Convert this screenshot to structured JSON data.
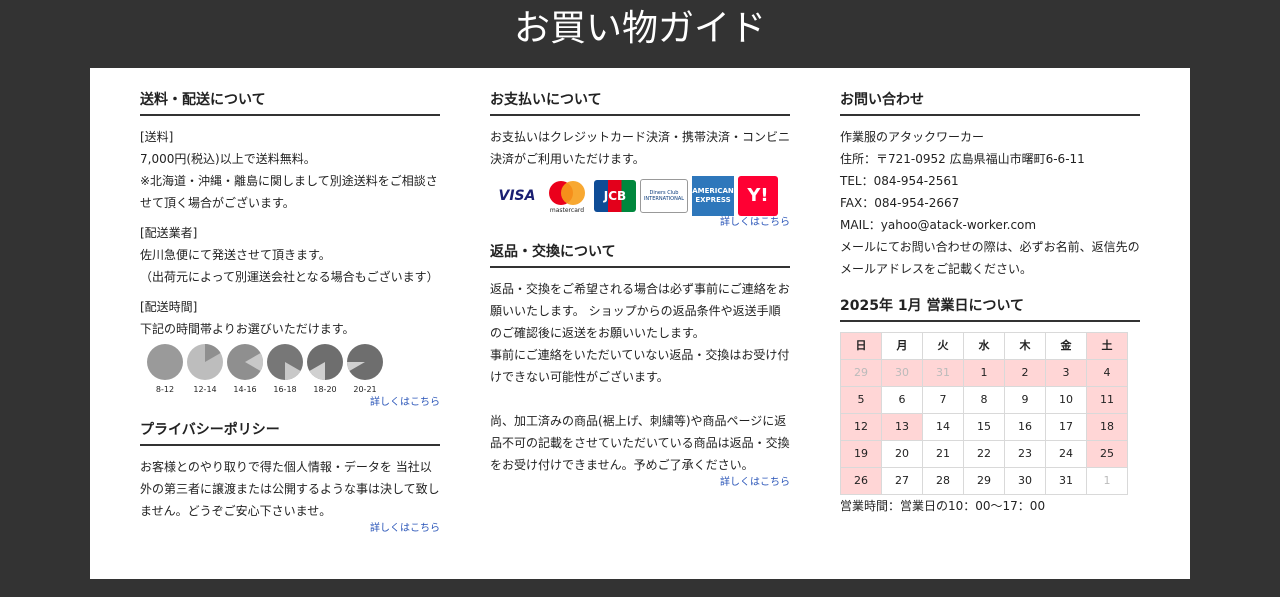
{
  "title": "お買い物ガイド",
  "shipping": {
    "heading": "送料・配送について",
    "fee_label": "[送料]",
    "fee_text1": "7,000円(税込)以上で送料無料。",
    "fee_text2a": "※北海道・沖縄・離島に関しまして別途送料をご相談さ",
    "fee_text2b": "せて頂く場合がございます。",
    "carrier_label": "[配送業者]",
    "carrier_text1": "佐川急便にて発送させて頂きます。",
    "carrier_text2": "（出荷元によって別運送会社となる場合もございます）",
    "time_label": "[配送時間]",
    "time_text": "下記の時間帯よりお選びいただけます。",
    "slots": [
      "8-12",
      "12-14",
      "14-16",
      "16-18",
      "18-20",
      "20-21"
    ],
    "more": "詳しくはこちら"
  },
  "privacy": {
    "heading": "プライバシーポリシー",
    "line1": "お客様とのやり取りで得た個人情報・データを 当社以",
    "line2": "外の第三者に譲渡または公開するような事は決して致し",
    "line3": "ません。どうぞご安心下さいませ。",
    "more": "詳しくはこちら"
  },
  "payment": {
    "heading": "お支払いについて",
    "line1": "お支払いはクレジットカード決済・携帯決済・コンビニ",
    "line2": "決済がご利用いただけます。",
    "cards": [
      "VISA",
      "mastercard",
      "JCB",
      "Diners Club INTERNATIONAL",
      "AMERICAN EXPRESS",
      "Y!"
    ],
    "more": "詳しくはこちら"
  },
  "returns": {
    "heading": "返品・交換について",
    "l1": "返品・交換をご希望される場合は必ず事前にご連絡をお",
    "l2": "願いいたします。 ショップからの返品条件や返送手順",
    "l3": "のご確認後に返送をお願いいたします。",
    "l4": "事前にご連絡をいただいていない返品・交換はお受け付",
    "l5": "けできない可能性がございます。",
    "l6": "尚、加工済みの商品(裾上げ、刺繍等)や商品ページに返",
    "l7": "品不可の記載をさせていただいている商品は返品・交換",
    "l8": "をお受け付けできません。予めご了承ください。",
    "more": "詳しくはこちら"
  },
  "contact": {
    "heading": "お問い合わせ",
    "company": "作業服のアタックワーカー",
    "address": "住所：〒721-0952 広島県福山市曙町6-6-11",
    "tel": "TEL：084-954-2561",
    "fax": "FAX：084-954-2667",
    "mail": "MAIL：yahoo@atack-worker.com",
    "note1": "メールにてお問い合わせの際は、必ずお名前、返信先の",
    "note2": "メールアドレスをご記載ください。"
  },
  "calendar": {
    "heading": "2025年 1月 営業日について",
    "weekdays": [
      "日",
      "月",
      "火",
      "水",
      "木",
      "金",
      "土"
    ],
    "weeks": [
      [
        "29",
        "30",
        "31",
        "1",
        "2",
        "3",
        "4"
      ],
      [
        "5",
        "6",
        "7",
        "8",
        "9",
        "10",
        "11"
      ],
      [
        "12",
        "13",
        "14",
        "15",
        "16",
        "17",
        "18"
      ],
      [
        "19",
        "20",
        "21",
        "22",
        "23",
        "24",
        "25"
      ],
      [
        "26",
        "27",
        "28",
        "29",
        "30",
        "31",
        "1"
      ]
    ],
    "holiday_color": "#ffd6d6",
    "hours": "営業時間：営業日の10：00〜17：00"
  }
}
